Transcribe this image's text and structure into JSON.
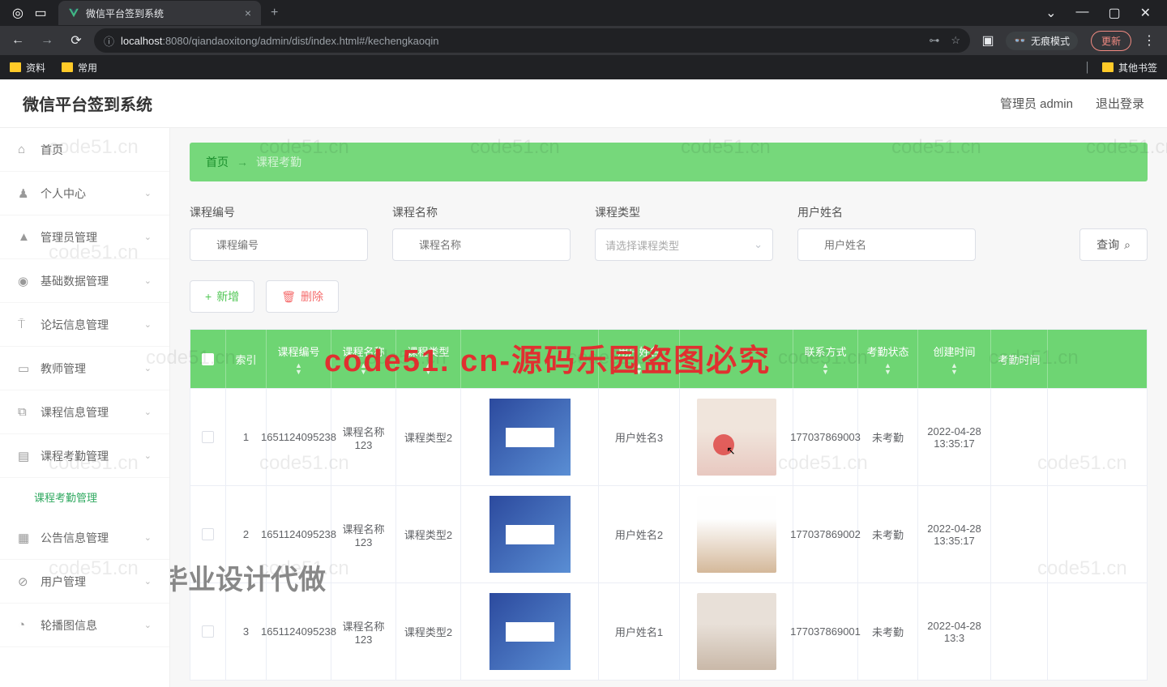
{
  "browser": {
    "tab_title": "微信平台签到系统",
    "url_prefix": "localhost",
    "url_path": ":8080/qiandaoxitong/admin/dist/index.html#/kechengkaoqin",
    "incognito_label": "无痕模式",
    "update_label": "更新",
    "bookmarks": [
      "资料",
      "常用"
    ],
    "other_bookmarks": "其他书签"
  },
  "header": {
    "title": "微信平台签到系统",
    "admin_label": "管理员 admin",
    "logout_label": "退出登录"
  },
  "sidebar": {
    "items": [
      {
        "label": "首页",
        "icon": "⌂",
        "expandable": false
      },
      {
        "label": "个人中心",
        "icon": "👤",
        "expandable": true
      },
      {
        "label": "管理员管理",
        "icon": "👤",
        "expandable": true
      },
      {
        "label": "基础数据管理",
        "icon": "◉",
        "expandable": true
      },
      {
        "label": "论坛信息管理",
        "icon": "🎤",
        "expandable": true
      },
      {
        "label": "教师管理",
        "icon": "💬",
        "expandable": true
      },
      {
        "label": "课程信息管理",
        "icon": "⧉",
        "expandable": true
      },
      {
        "label": "课程考勤管理",
        "icon": "📋",
        "expandable": true,
        "active": true
      },
      {
        "label": "公告信息管理",
        "icon": "▦",
        "expandable": true
      },
      {
        "label": "用户管理",
        "icon": "⊘",
        "expandable": true
      },
      {
        "label": "轮播图信息",
        "icon": "◔",
        "expandable": true
      }
    ],
    "submenu_active": "课程考勤管理"
  },
  "breadcrumb": {
    "home": "首页",
    "arrow": "→",
    "current": "课程考勤"
  },
  "filters": {
    "code_label": "课程编号",
    "code_placeholder": "课程编号",
    "name_label": "课程名称",
    "name_placeholder": "课程名称",
    "type_label": "课程类型",
    "type_placeholder": "请选择课程类型",
    "user_label": "用户姓名",
    "user_placeholder": "用户姓名",
    "query_btn": "查询"
  },
  "actions": {
    "add": "新增",
    "delete": "删除"
  },
  "table": {
    "headers": [
      "",
      "索引",
      "课程编号",
      "课程名称",
      "课程类型",
      "",
      "用户姓名",
      "",
      "联系方式",
      "考勤状态",
      "创建时间",
      "考勤时间"
    ],
    "rows": [
      {
        "idx": "1",
        "code": "1651124095238",
        "name": "课程名称123",
        "type": "课程类型2",
        "user": "用户姓名3",
        "phone": "177037869003",
        "status": "未考勤",
        "time": "2022-04-28 13:35:17"
      },
      {
        "idx": "2",
        "code": "1651124095238",
        "name": "课程名称123",
        "type": "课程类型2",
        "user": "用户姓名2",
        "phone": "177037869002",
        "status": "未考勤",
        "time": "2022-04-28 13:35:17"
      },
      {
        "idx": "3",
        "code": "1651124095238",
        "name": "课程名称123",
        "type": "课程类型2",
        "user": "用户姓名1",
        "phone": "177037869001",
        "status": "未考勤",
        "time": "2022-04-28 13:3"
      }
    ]
  },
  "watermarks": {
    "code51": "code51.cn",
    "red_banner": "code51. cn-源码乐园盗图必究",
    "gray_banner": "专业毕业设计代做"
  }
}
